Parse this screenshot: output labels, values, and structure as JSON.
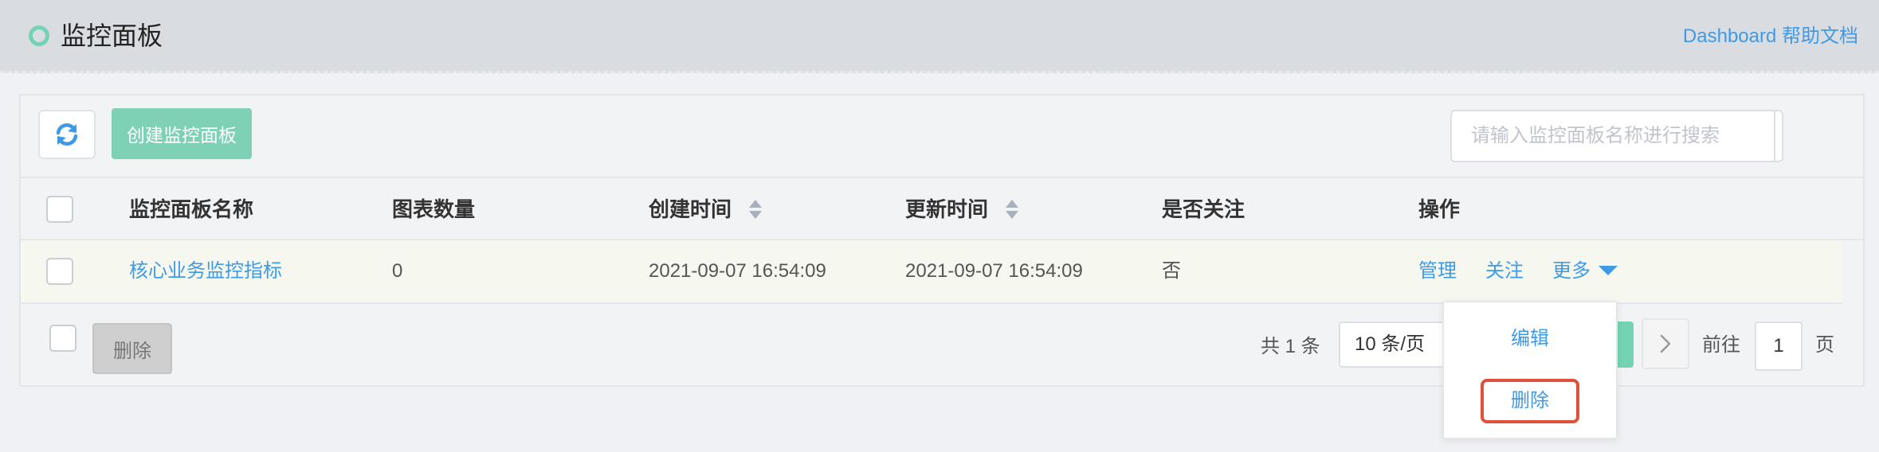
{
  "header": {
    "title": "监控面板",
    "help_link": "Dashboard 帮助文档"
  },
  "toolbar": {
    "create_label": "创建监控面板",
    "search_placeholder": "请输入监控面板名称进行搜索"
  },
  "table": {
    "columns": [
      "监控面板名称",
      "图表数量",
      "创建时间",
      "更新时间",
      "是否关注",
      "操作"
    ],
    "rows": [
      {
        "name": "核心业务监控指标",
        "chart_count": "0",
        "created": "2021-09-07 16:54:09",
        "updated": "2021-09-07 16:54:09",
        "followed": "否",
        "actions": [
          "管理",
          "关注",
          "更多"
        ]
      }
    ]
  },
  "footer": {
    "delete_label": "删除",
    "total": "共 1 条",
    "page_size": "10 条/页",
    "goto_label": "前往",
    "goto_value": "1",
    "page_unit": "页"
  },
  "dropdown": {
    "items": [
      "编辑",
      "删除"
    ]
  },
  "colors": {
    "accent": "#3f9ae5",
    "primary": "#7fd1b5",
    "highlight": "#e0503a"
  }
}
